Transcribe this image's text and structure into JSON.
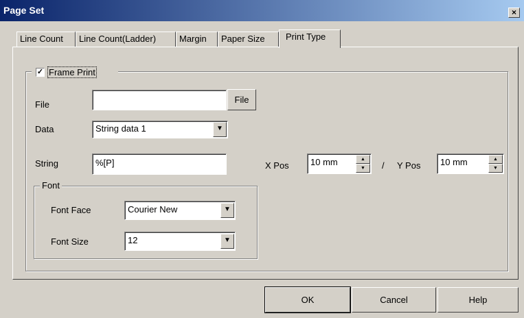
{
  "window": {
    "title": "Page Set",
    "close_glyph": "×"
  },
  "tabs": [
    {
      "label": "Line Count"
    },
    {
      "label": "Line Count(Ladder)"
    },
    {
      "label": "Margin"
    },
    {
      "label": "Paper Size"
    },
    {
      "label": "Print Type"
    }
  ],
  "frame_print": {
    "label": "Frame Print",
    "checked": true,
    "check_glyph": "✓"
  },
  "file": {
    "label": "File",
    "value": "",
    "button_label": "File"
  },
  "data": {
    "label": "Data",
    "value": "String data 1"
  },
  "string": {
    "label": "String",
    "value": "%[P]"
  },
  "xpos": {
    "label": "X Pos",
    "value": "10 mm"
  },
  "separator": "/",
  "ypos": {
    "label": "Y Pos",
    "value": "10 mm"
  },
  "font": {
    "group_label": "Font",
    "face_label": "Font Face",
    "face_value": "Courier New",
    "size_label": "Font Size",
    "size_value": "12"
  },
  "buttons": {
    "ok": "OK",
    "cancel": "Cancel",
    "help": "Help"
  },
  "icons": {
    "dropdown_arrow": "▼",
    "spin_up": "▲",
    "spin_down": "▼"
  }
}
